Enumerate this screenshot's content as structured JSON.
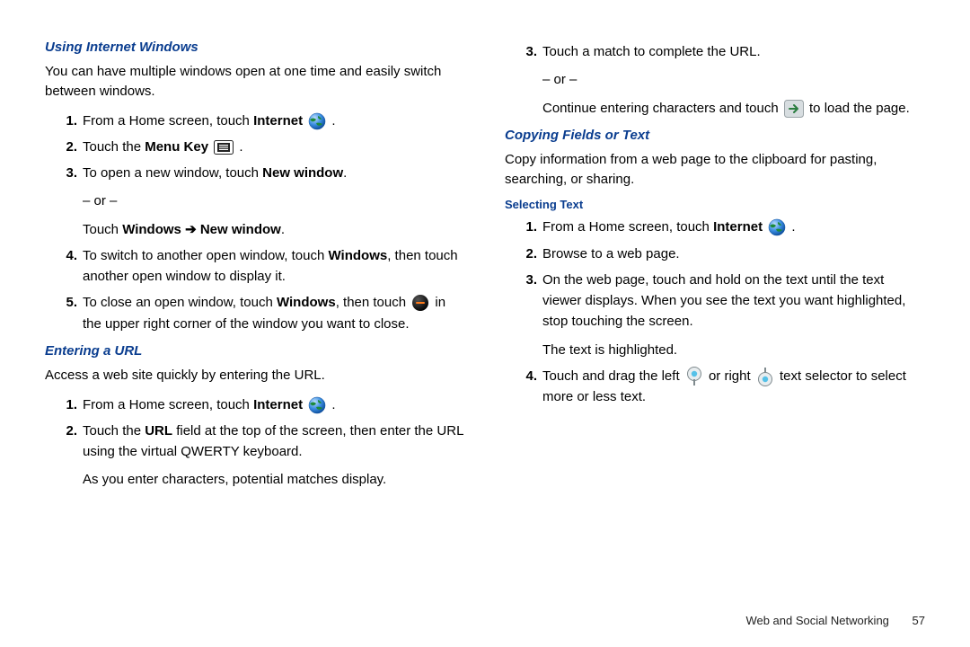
{
  "left": {
    "section1": {
      "heading": "Using Internet Windows",
      "body": "You can have multiple windows open at one time and easily switch between windows.",
      "steps": {
        "s1_a": "From a Home screen, touch ",
        "s1_b": "Internet",
        "s1_c": " .",
        "s2_a": "Touch the ",
        "s2_b": "Menu Key",
        "s2_c": " .",
        "s3_a": "To open a new window, touch ",
        "s3_b": "New window",
        "s3_c": ".",
        "s3_or": "– or –",
        "s3_d": "Touch ",
        "s3_e": "Windows",
        "s3_arrow": " ➔ ",
        "s3_f": "New window",
        "s3_g": ".",
        "s4_a": "To switch to another open window, touch ",
        "s4_b": "Windows",
        "s4_c": ", then touch another open window to display it.",
        "s5_a": "To close an open window, touch ",
        "s5_b": "Windows",
        "s5_c": ", then touch ",
        "s5_d": " in the upper right corner of the window you want to close."
      }
    },
    "section2": {
      "heading": "Entering a URL",
      "body": "Access a web site quickly by entering the URL.",
      "steps": {
        "s1_a": "From a Home screen, touch ",
        "s1_b": "Internet",
        "s1_c": " .",
        "s2_a": "Touch the ",
        "s2_b": "URL",
        "s2_c": " field at the top of the screen, then enter the URL using the virtual QWERTY keyboard.",
        "s2_cont": "As you enter characters, potential matches display."
      }
    }
  },
  "right": {
    "cont_steps": {
      "s3_a": "Touch a match to complete the URL.",
      "s3_or": "– or –",
      "s3_b": "Continue entering characters and touch ",
      "s3_c": " to load the page."
    },
    "section3": {
      "heading": "Copying Fields or Text",
      "body": "Copy information from a web page to the clipboard for pasting, searching, or sharing."
    },
    "section4": {
      "heading": "Selecting Text",
      "steps": {
        "s1_a": "From a Home screen, touch ",
        "s1_b": "Internet",
        "s1_c": " .",
        "s2": "Browse to a web page.",
        "s3_a": "On the web page, touch and hold on the text until the text viewer displays. When you see the text you want highlighted, stop touching the screen.",
        "s3_cont": "The text is highlighted.",
        "s4_a": "Touch and drag the left ",
        "s4_b": " or right ",
        "s4_c": " text selector to select more or less text."
      }
    }
  },
  "footer": {
    "section": "Web and Social Networking",
    "page": "57"
  }
}
